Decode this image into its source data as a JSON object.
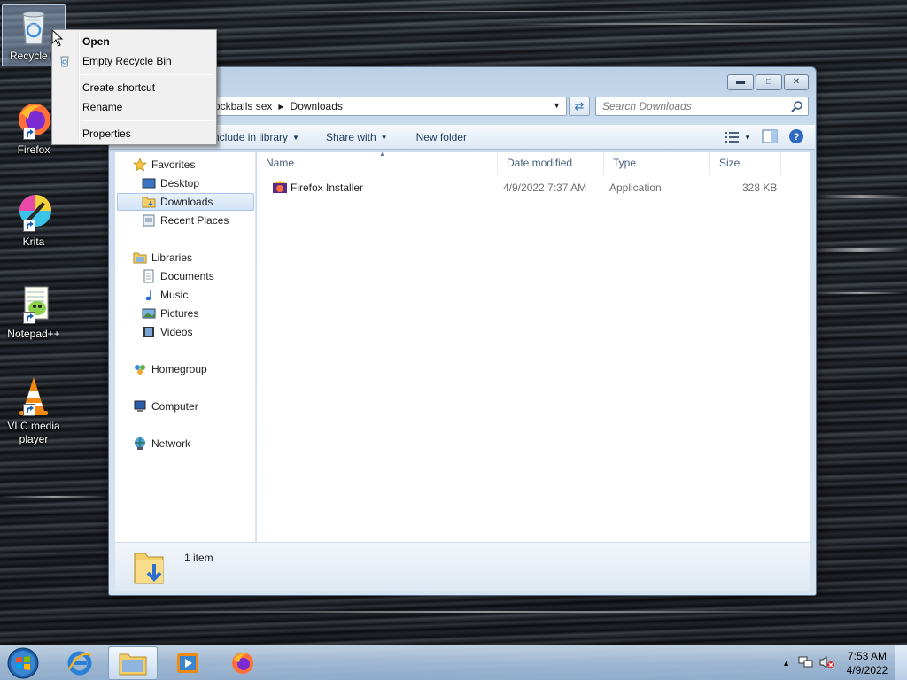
{
  "desktop": {
    "icons": [
      {
        "label": "Recycle Bin",
        "visible_label": "Recycle B"
      },
      {
        "label": "Firefox"
      },
      {
        "label": "Krita"
      },
      {
        "label": "Notepad++"
      },
      {
        "label": "VLC media player"
      }
    ]
  },
  "context_menu": {
    "items": [
      "Open",
      "Empty Recycle Bin",
      "Create shortcut",
      "Rename",
      "Properties"
    ]
  },
  "explorer": {
    "breadcrumb": [
      "ockballs sex",
      "Downloads"
    ],
    "search_placeholder": "Search Downloads",
    "toolbar": {
      "include_in_library": "nclude in library",
      "share_with": "Share with",
      "new_folder": "New folder"
    },
    "nav": {
      "favorites": "Favorites",
      "desktop": "Desktop",
      "downloads": "Downloads",
      "recent_places": "Recent Places",
      "libraries": "Libraries",
      "documents": "Documents",
      "music": "Music",
      "pictures": "Pictures",
      "videos": "Videos",
      "homegroup": "Homegroup",
      "computer": "Computer",
      "network": "Network"
    },
    "columns": {
      "name": "Name",
      "date_modified": "Date modified",
      "type": "Type",
      "size": "Size"
    },
    "files": [
      {
        "name": "Firefox Installer",
        "date_modified": "4/9/2022 7:37 AM",
        "type": "Application",
        "size": "328 KB"
      }
    ],
    "status": "1 item"
  },
  "taskbar": {
    "clock_time": "7:53 AM",
    "clock_date": "4/9/2022"
  },
  "colors": {
    "selection": "#d3e4f7",
    "link_blue": "#1e395b",
    "firefox_orange": "#ff7139"
  }
}
